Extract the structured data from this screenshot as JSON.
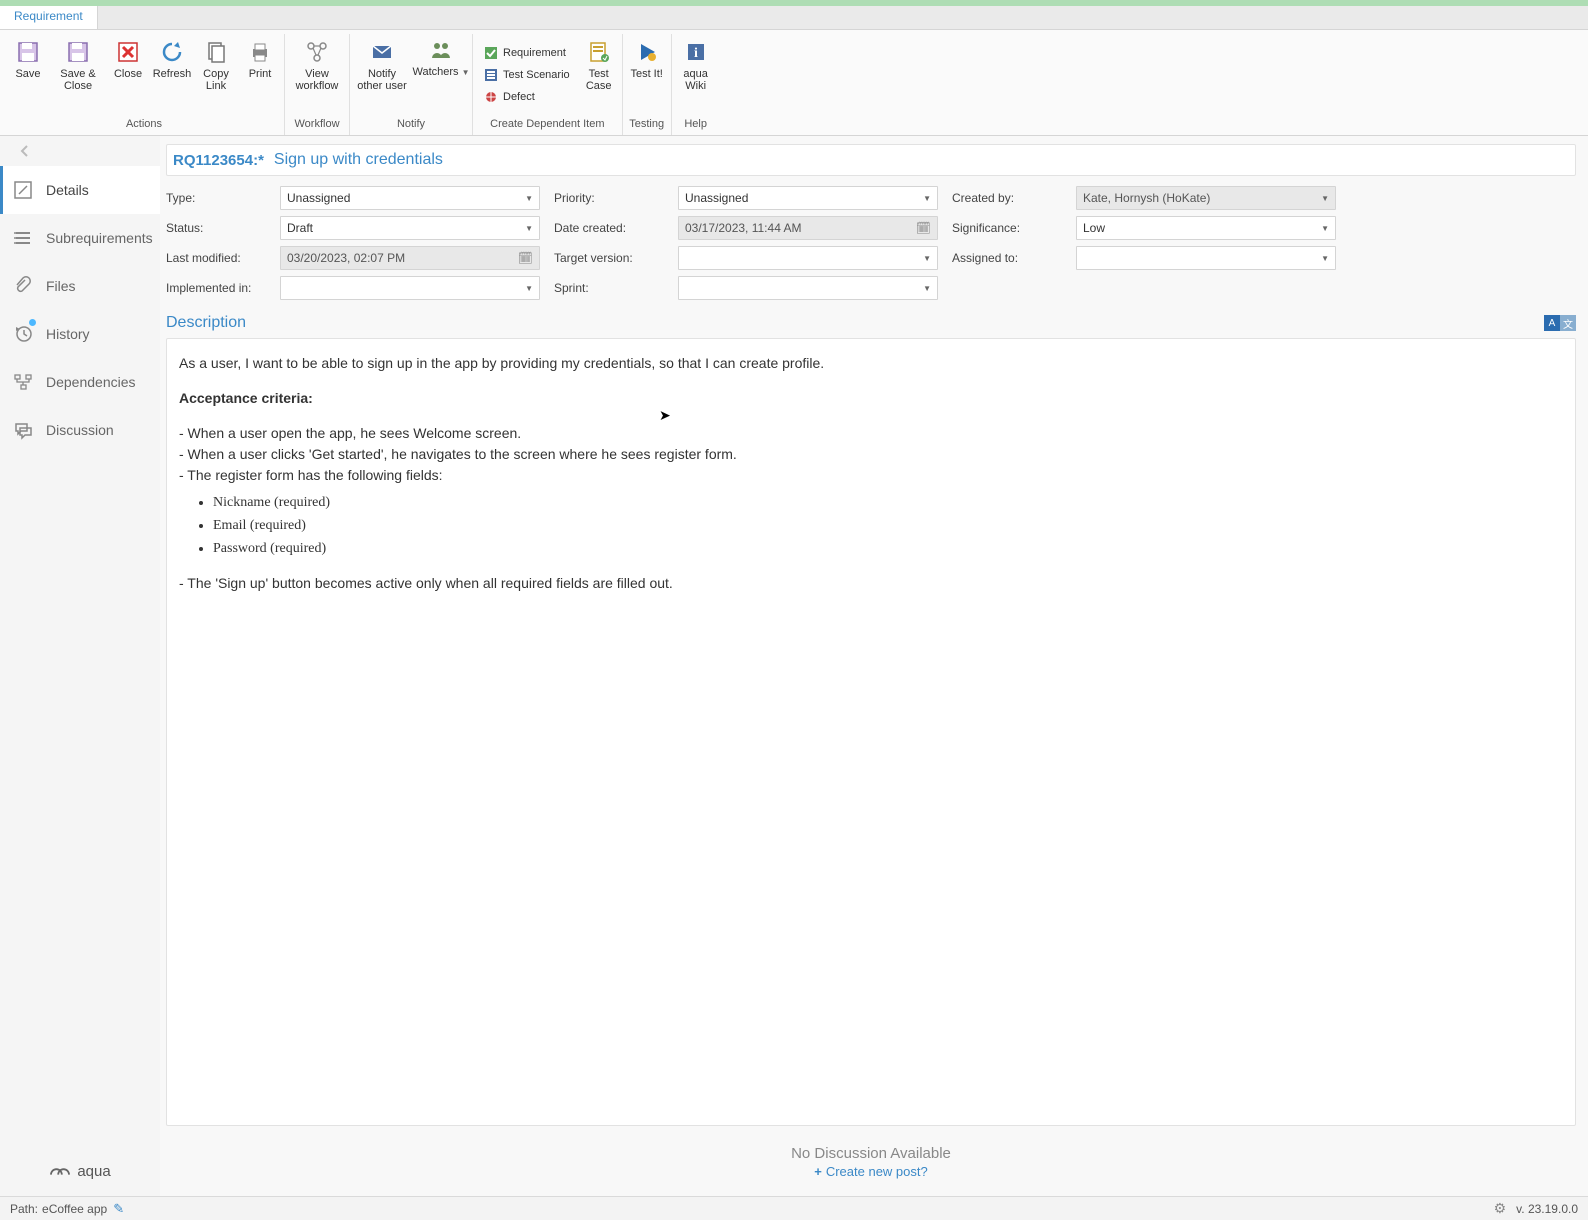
{
  "tab": {
    "label": "Requirement"
  },
  "ribbon": {
    "actions": {
      "save": "Save",
      "saveclose": "Save & Close",
      "close": "Close",
      "refresh": "Refresh",
      "copylink": "Copy Link",
      "print": "Print",
      "group_label": "Actions"
    },
    "workflow": {
      "view": "View workflow",
      "group_label": "Workflow"
    },
    "notify": {
      "other": "Notify other user",
      "watchers": "Watchers",
      "group_label": "Notify"
    },
    "dependent": {
      "requirement": "Requirement",
      "scenario": "Test Scenario",
      "defect": "Defect",
      "testcase": "Test Case",
      "group_label": "Create Dependent Item"
    },
    "testing": {
      "testit": "Test It!",
      "group_label": "Testing"
    },
    "help": {
      "wiki": "aqua Wiki",
      "group_label": "Help"
    }
  },
  "sidebar": {
    "details": "Details",
    "subreq": "Subrequirements",
    "files": "Files",
    "history": "History",
    "dependencies": "Dependencies",
    "discussion": "Discussion"
  },
  "header": {
    "id": "RQ1123654:*",
    "title": "Sign up with credentials"
  },
  "fields": {
    "type_label": "Type:",
    "type_value": "Unassigned",
    "priority_label": "Priority:",
    "priority_value": "Unassigned",
    "createdby_label": "Created by:",
    "createdby_value": "Kate, Hornysh (HoKate)",
    "status_label": "Status:",
    "status_value": "Draft",
    "datecreated_label": "Date created:",
    "datecreated_value": "03/17/2023, 11:44 AM",
    "significance_label": "Significance:",
    "significance_value": "Low",
    "lastmod_label": "Last modified:",
    "lastmod_value": "03/20/2023, 02:07 PM",
    "targetver_label": "Target version:",
    "targetver_value": "",
    "assignedto_label": "Assigned to:",
    "assignedto_value": "",
    "implemented_label": "Implemented in:",
    "implemented_value": "",
    "sprint_label": "Sprint:",
    "sprint_value": ""
  },
  "description": {
    "title": "Description",
    "intro": "As a user, I want to be able to sign up in the app by providing my credentials, so that I can create profile.",
    "ac_label": "Acceptance criteria:",
    "line1": "- When a user open the app, he sees Welcome screen.",
    "line2": "- When a user clicks 'Get started', he navigates to the screen where he sees register form.",
    "line3": "- The register form has the following fields:",
    "bullet1": "Nickname (required)",
    "bullet2": "Email (required)",
    "bullet3": "Password (required)",
    "line4": "- The 'Sign up' button becomes active only when all required fields are filled out."
  },
  "discussion_area": {
    "nodisc": "No Discussion Available",
    "create": "Create new post?"
  },
  "brand": {
    "name": "aqua"
  },
  "statusbar": {
    "path_label": "Path:",
    "path_value": "eCoffee app",
    "version": "v. 23.19.0.0"
  }
}
